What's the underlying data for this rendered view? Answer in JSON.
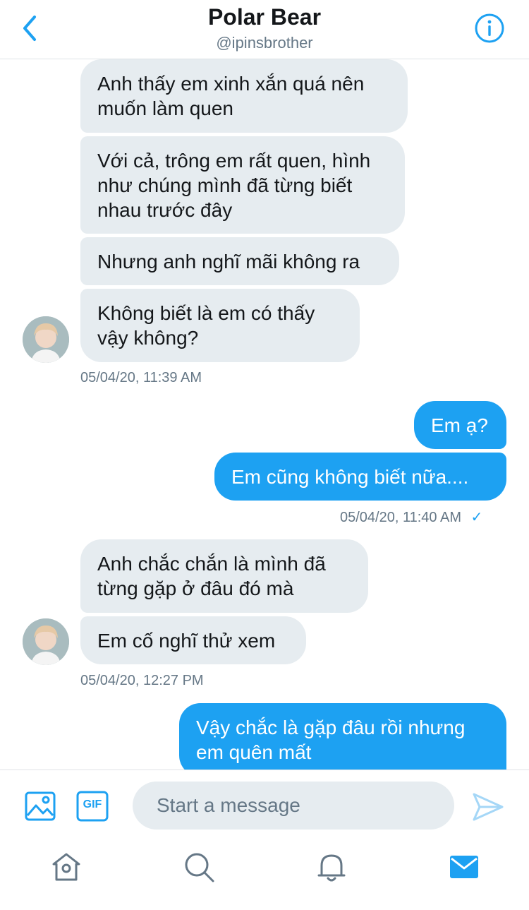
{
  "header": {
    "title": "Polar Bear",
    "handle": "@ipinsbrother"
  },
  "messages": [
    {
      "side": "received",
      "text": "Anh thấy em xinh xắn quá nên muốn làm quen"
    },
    {
      "side": "received",
      "text": "Với cả, trông em rất quen, hình như chúng mình đã từng biết nhau trước đây"
    },
    {
      "side": "received",
      "text": "Nhưng anh nghĩ mãi không ra"
    },
    {
      "side": "received",
      "text": "Không biết là em có thấy vậy không?"
    },
    {
      "side": "received",
      "text": "Anh chắc chắn là mình đã từng gặp ở đâu đó mà"
    },
    {
      "side": "received",
      "text": "Em cố nghĩ thử xem"
    },
    {
      "side": "sent",
      "text": "Em ạ?"
    },
    {
      "side": "sent",
      "text": "Em cũng không biết nữa...."
    },
    {
      "side": "sent",
      "text": "Vậy chắc là gặp đâu rồi nhưng em quên mất"
    }
  ],
  "timestamps": {
    "group1": "05/04/20, 11:39 AM",
    "group2": "05/04/20, 11:40 AM",
    "group2_check": "✓",
    "group3": "05/04/20, 12:27 PM"
  },
  "composer": {
    "placeholder": "Start a message",
    "gif_label": "GIF"
  },
  "icons": {
    "back": "chevron-left-icon",
    "info": "info-icon",
    "image": "image-icon",
    "gif": "gif-icon",
    "send": "send-icon",
    "home": "home-icon",
    "search": "search-icon",
    "notifications": "bell-icon",
    "messages": "mail-icon"
  },
  "colors": {
    "accent": "#1da1f2",
    "received_bubble": "#e6ecf0",
    "secondary_text": "#657786"
  }
}
